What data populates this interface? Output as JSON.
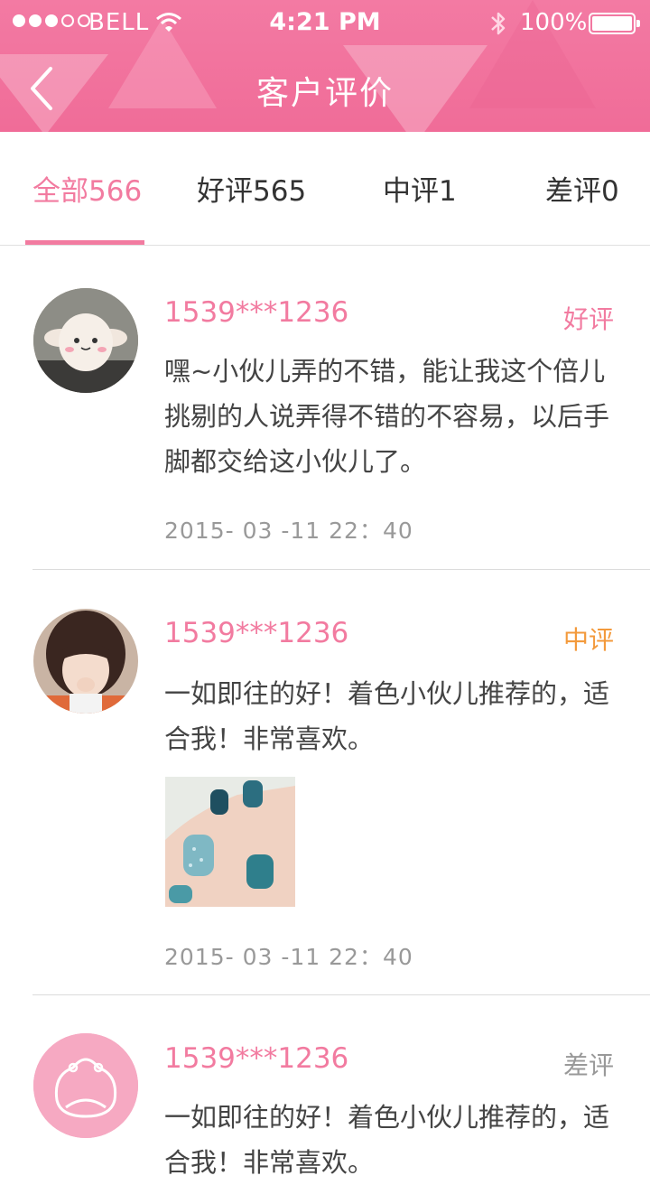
{
  "status_bar": {
    "carrier": "BELL",
    "time": "4:21 PM",
    "battery": "100%"
  },
  "nav": {
    "title": "客户评价"
  },
  "tabs": [
    {
      "label": "全部566",
      "active": true
    },
    {
      "label": "好评565",
      "active": false
    },
    {
      "label": "中评1",
      "active": false
    },
    {
      "label": "差评0",
      "active": false
    }
  ],
  "reviews": [
    {
      "user": "1539***1236",
      "rating": "好评",
      "rating_color": "#f27ba0",
      "text": "嘿~小伙儿弄的不错，能让我这个倍儿挑剔的人说弄得不错的不容易，以后手脚都交给这小伙儿了。",
      "date": "2015- 03 -11  22：40"
    },
    {
      "user": "1539***1236",
      "rating": "中评",
      "rating_color": "#f39a3c",
      "text": "一如即往的好！着色小伙儿推荐的，适合我！非常喜欢。",
      "date": "2015- 03 -11  22：40"
    },
    {
      "user": "1539***1236",
      "rating": "差评",
      "rating_color": "#999999",
      "text": "一如即往的好！着色小伙儿推荐的，适合我！非常喜欢。",
      "date": ""
    }
  ],
  "colors": {
    "accent": "#f27ba0",
    "header": "#f06c98"
  }
}
